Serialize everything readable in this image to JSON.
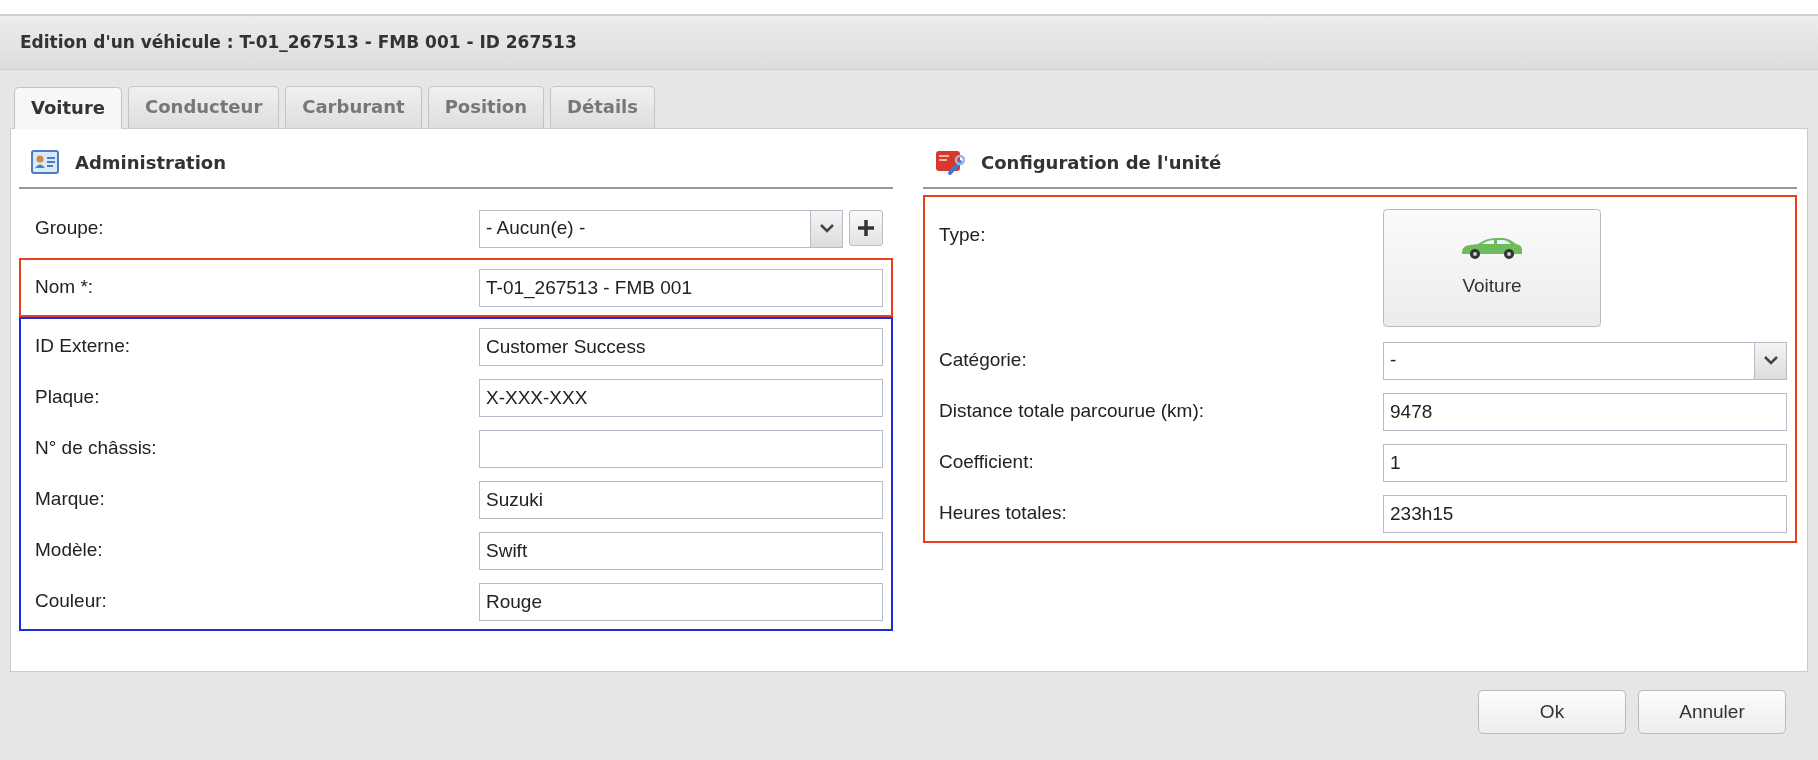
{
  "window": {
    "title": "Edition d'un véhicule : T-01_267513 - FMB 001 - ID 267513"
  },
  "tabs": [
    {
      "label": "Voiture",
      "selected": true
    },
    {
      "label": "Conducteur",
      "selected": false
    },
    {
      "label": "Carburant",
      "selected": false
    },
    {
      "label": "Position",
      "selected": false
    },
    {
      "label": "Détails",
      "selected": false
    }
  ],
  "sections": [
    {
      "title": "Administration",
      "kind": "admin",
      "groups": [
        {
          "fields": [
            {
              "kind": "select",
              "label": "Groupe:",
              "value": "- Aucun(e) -",
              "add_button": true
            }
          ]
        },
        {
          "color": "#e8401c",
          "fields": [
            {
              "kind": "text",
              "label": "Nom *:",
              "value": "T-01_267513 - FMB 001"
            }
          ]
        },
        {
          "color": "#1a2fe0",
          "fields": [
            {
              "kind": "text",
              "label": "ID Externe:",
              "value": "Customer Success"
            },
            {
              "kind": "text",
              "label": "Plaque:",
              "value": "X-XXX-XXX"
            },
            {
              "kind": "text",
              "label": "N° de châssis:"
            },
            {
              "kind": "text",
              "label": "Marque:",
              "value": "Suzuki"
            },
            {
              "kind": "text",
              "label": "Modèle:",
              "value": "Swift"
            },
            {
              "kind": "text",
              "label": "Couleur:",
              "value": "Rouge"
            }
          ]
        }
      ]
    },
    {
      "title": "Configuration de l'unité",
      "kind": "config",
      "groups": [
        {
          "color": "#e8401c",
          "fields": [
            {
              "kind": "type_button",
              "label": "Type:",
              "value": "Voiture"
            },
            {
              "kind": "select",
              "label": "Catégorie:",
              "value": "-",
              "add_button": false
            },
            {
              "kind": "text",
              "label": "Distance totale parcourue (km):",
              "value": "9478"
            },
            {
              "kind": "text",
              "label": "Coefficient:",
              "value": "1"
            },
            {
              "kind": "text",
              "label": "Heures totales:",
              "value": "233h15"
            }
          ]
        }
      ]
    }
  ],
  "buttons": [
    "Ok",
    "Annuler"
  ]
}
